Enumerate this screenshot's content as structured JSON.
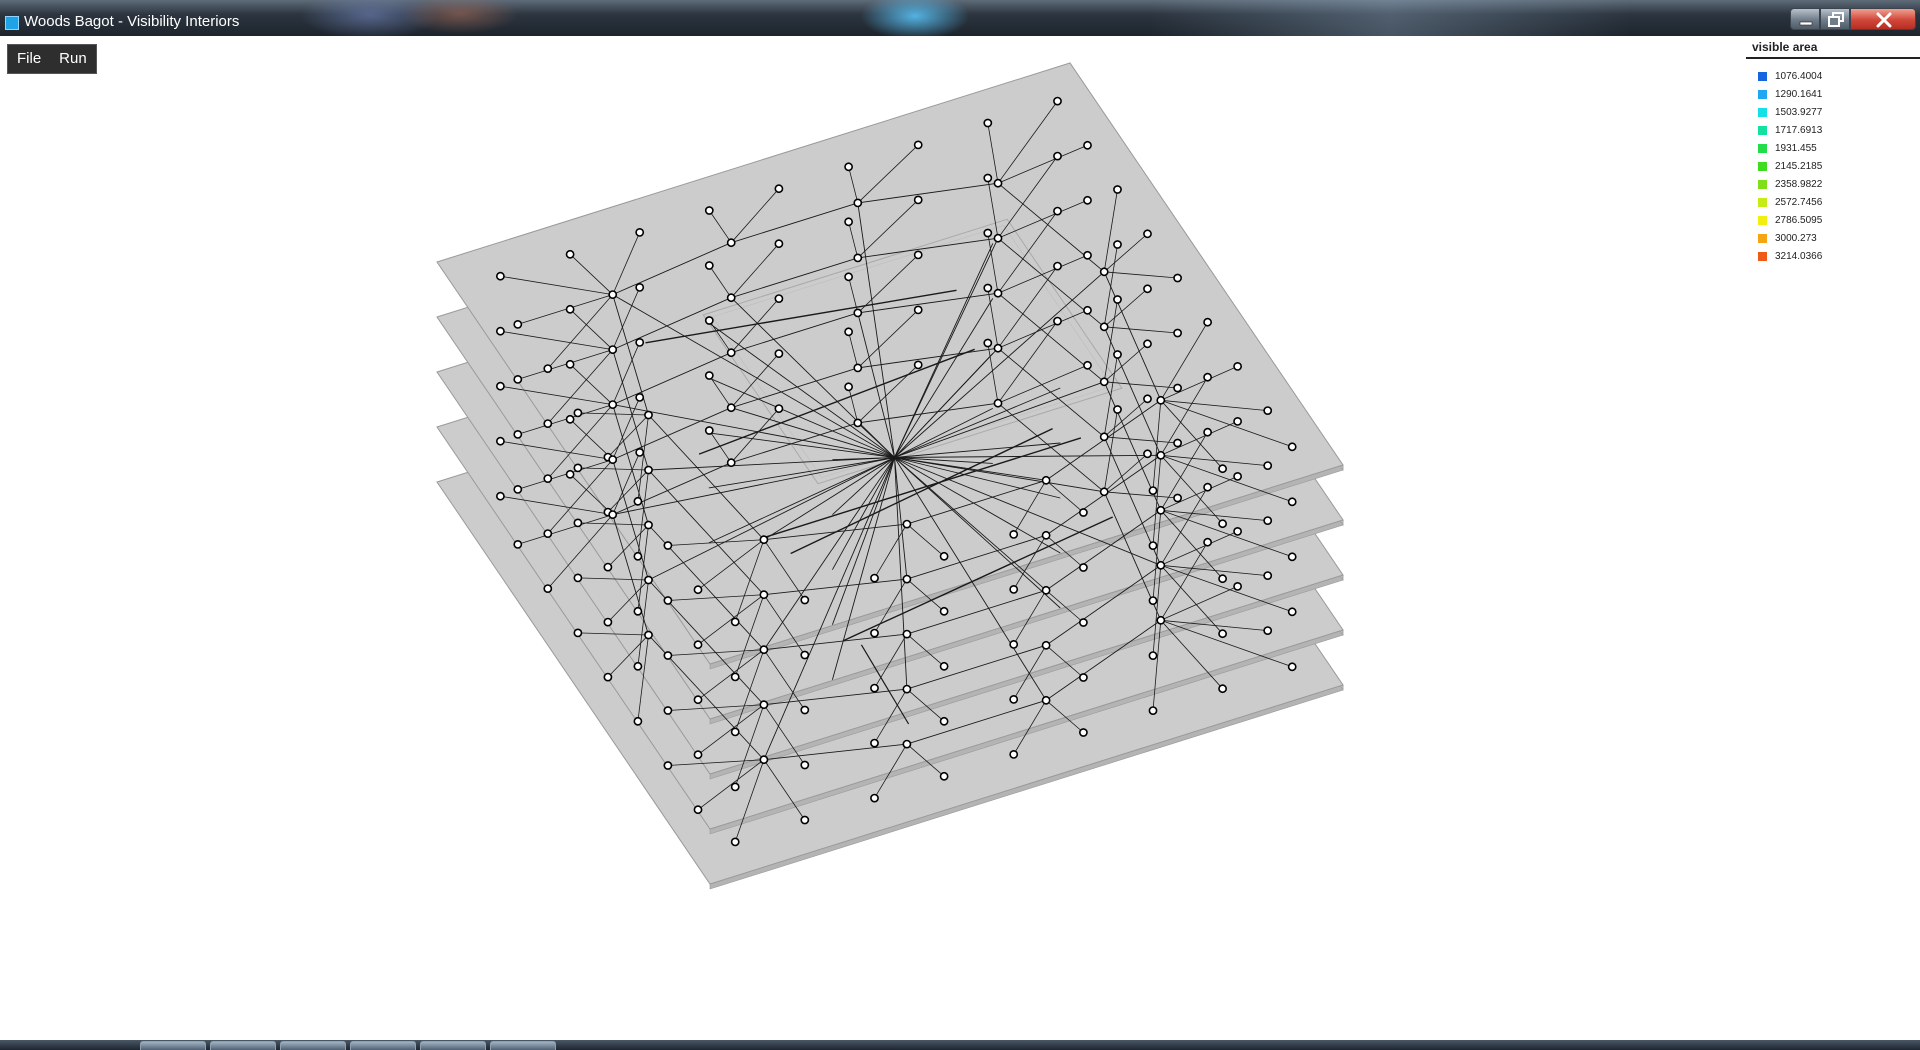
{
  "window": {
    "title": "Woods Bagot - Visibility Interiors"
  },
  "menu": {
    "items": [
      {
        "label": "File"
      },
      {
        "label": "Run"
      }
    ]
  },
  "legend": {
    "title": "visible area",
    "entries": [
      {
        "value": "1076.4004",
        "color": "#1565e0"
      },
      {
        "value": "1290.1641",
        "color": "#1ea7f2"
      },
      {
        "value": "1503.9277",
        "color": "#14e0e8"
      },
      {
        "value": "1717.6913",
        "color": "#14e0a0"
      },
      {
        "value": "1931.455",
        "color": "#22dd4a"
      },
      {
        "value": "2145.2185",
        "color": "#3fdd1e"
      },
      {
        "value": "2358.9822",
        "color": "#7fe01a"
      },
      {
        "value": "2572.7456",
        "color": "#c6ec18"
      },
      {
        "value": "2786.5095",
        "color": "#f2ee10"
      },
      {
        "value": "3000.273",
        "color": "#f5a414"
      },
      {
        "value": "3214.0366",
        "color": "#f05a18"
      }
    ]
  },
  "scene": {
    "floors": 5,
    "floor_color": "#cccccc",
    "edge_color": "#9a9a9a",
    "node_stroke": "#000000",
    "node_fill": "#ffffff"
  }
}
